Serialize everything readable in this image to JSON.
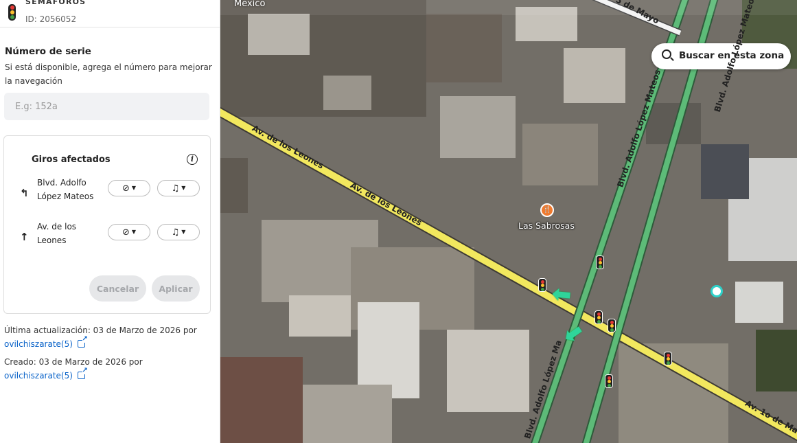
{
  "header": {
    "title": "SEMÁFOROS",
    "id_label": "ID: 2056052"
  },
  "serial": {
    "title": "Número de serie",
    "help": "Si está disponible, agrega el número para mejorar la navegación",
    "placeholder": "E.g: 152a",
    "value": ""
  },
  "turns": {
    "title": "Giros afectados",
    "rows": [
      {
        "arrow": "↰",
        "street": "Blvd. Adolfo López Mateos"
      },
      {
        "arrow": "↑",
        "street": "Av. de los Leones"
      }
    ],
    "cancel_label": "Cancelar",
    "apply_label": "Aplicar"
  },
  "meta": {
    "updated_text": "Última actualización: 03 de Marzo de 2026 por",
    "updated_user": "ovilchiszarate(5)",
    "created_text": "Creado: 03 de Marzo de 2026 por",
    "created_user": "ovilchiszarate(5)"
  },
  "map": {
    "country": "Mexico",
    "search_label": "Buscar en esta zona",
    "poi_name": "Las Sabrosas",
    "road_labels": {
      "leones_1": "Av. de los Leones",
      "leones_2": "Av. de los Leones",
      "cinco_mayo": "5 de Mayo",
      "lopez_mateos_1": "Blvd. Adolfo López Mateos",
      "lopez_mateos_2": "Blvd. Adolfo López Mateos",
      "lopez_mateos_3": "Blvd. Adolfo López Ma",
      "primero_mayo": "Av. 1o de Ma"
    },
    "colors": {
      "primary_road": "#f2e85e",
      "green_road": "#5dbb78",
      "turn_arrow": "#2fd49a",
      "poi": "#ef7a2e",
      "link": "#0a63c9"
    }
  }
}
